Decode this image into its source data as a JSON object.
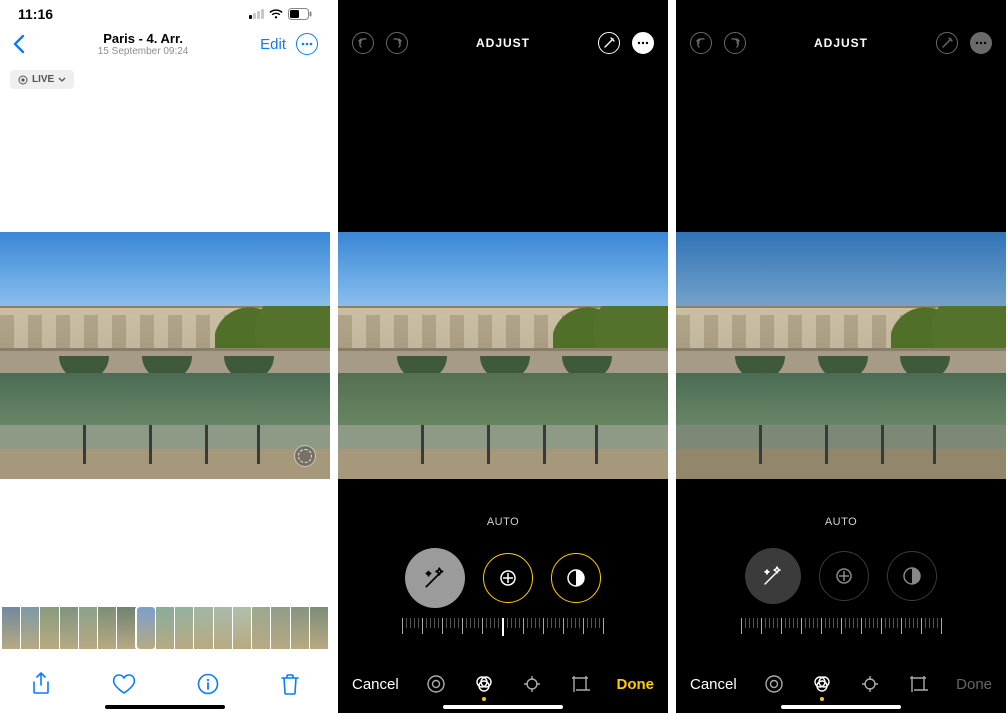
{
  "panelA": {
    "status_time": "11:16",
    "location_title": "Paris - 4. Arr.",
    "date_subtitle": "15 September  09:24",
    "edit_label": "Edit",
    "live_badge": "LIVE",
    "thumbs_count": 17,
    "selected_thumb_index": 7,
    "toolbar": [
      "share",
      "favorite",
      "info",
      "delete"
    ]
  },
  "panelB": {
    "top_label": "ADJUST",
    "mode_label": "AUTO",
    "cancel_label": "Cancel",
    "done_label": "Done",
    "done_enabled": true,
    "adjust_buttons": [
      "auto-wand",
      "exposure",
      "brilliance"
    ],
    "selected_adjust_index": 2,
    "bottom_tools": [
      "adjust",
      "filters",
      "crop",
      "markup"
    ],
    "selected_tool_index": 1
  },
  "panelC": {
    "top_label": "ADJUST",
    "mode_label": "AUTO",
    "cancel_label": "Cancel",
    "done_label": "Done",
    "done_enabled": false,
    "adjust_buttons": [
      "auto-wand",
      "exposure",
      "brilliance"
    ],
    "selected_adjust_index": -1,
    "bottom_tools": [
      "adjust",
      "filters",
      "crop",
      "markup"
    ],
    "selected_tool_index": 1
  }
}
